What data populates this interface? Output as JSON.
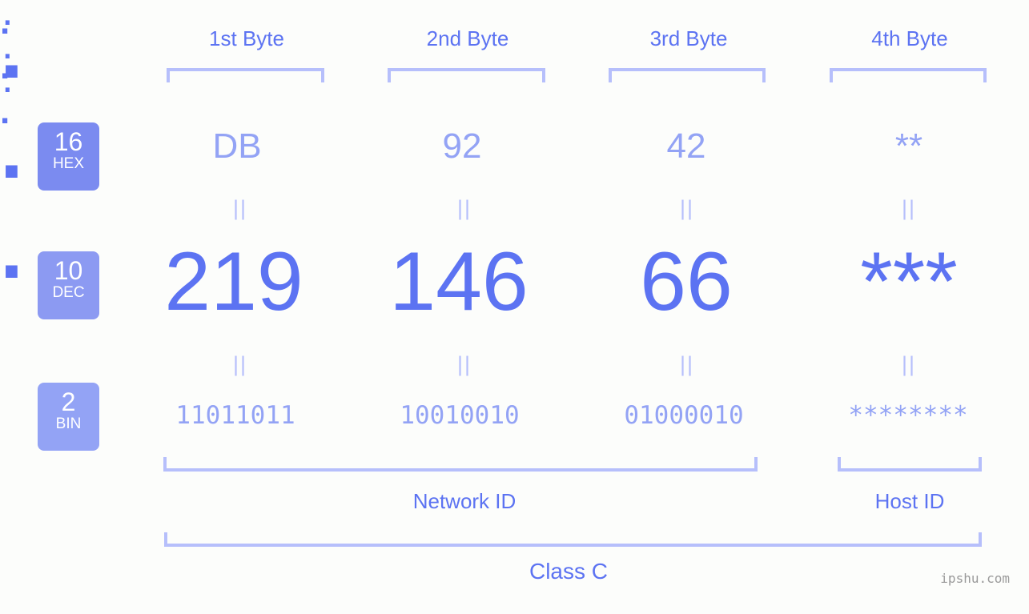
{
  "background_color": "#fcfdfb",
  "accent_color": "#5c73f2",
  "accent_light_color": "#93a3f5",
  "bracket_color": "#b6bffb",
  "headers": [
    {
      "label": "1st Byte"
    },
    {
      "label": "2nd Byte"
    },
    {
      "label": "3rd Byte"
    },
    {
      "label": "4th Byte"
    }
  ],
  "bases": [
    {
      "number": "16",
      "abbr": "HEX",
      "color": "#7b8bf0"
    },
    {
      "number": "10",
      "abbr": "DEC",
      "color": "#8c9af2"
    },
    {
      "number": "2",
      "abbr": "BIN",
      "color": "#93a3f5"
    }
  ],
  "rows": {
    "hex": {
      "base_number": "16",
      "base_abbr": "HEX",
      "values": [
        "DB",
        "92",
        "42",
        "**"
      ],
      "separator": "."
    },
    "dec": {
      "base_number": "10",
      "base_abbr": "DEC",
      "values": [
        "219",
        "146",
        "66",
        "***"
      ],
      "separator": "."
    },
    "bin": {
      "base_number": "2",
      "base_abbr": "BIN",
      "values": [
        "11011011",
        "10010010",
        "01000010",
        "********"
      ],
      "separator": "."
    }
  },
  "equals_symbol": "||",
  "sections": {
    "network_id": "Network ID",
    "host_id": "Host ID",
    "class": "Class C"
  },
  "watermark": "ipshu.com"
}
